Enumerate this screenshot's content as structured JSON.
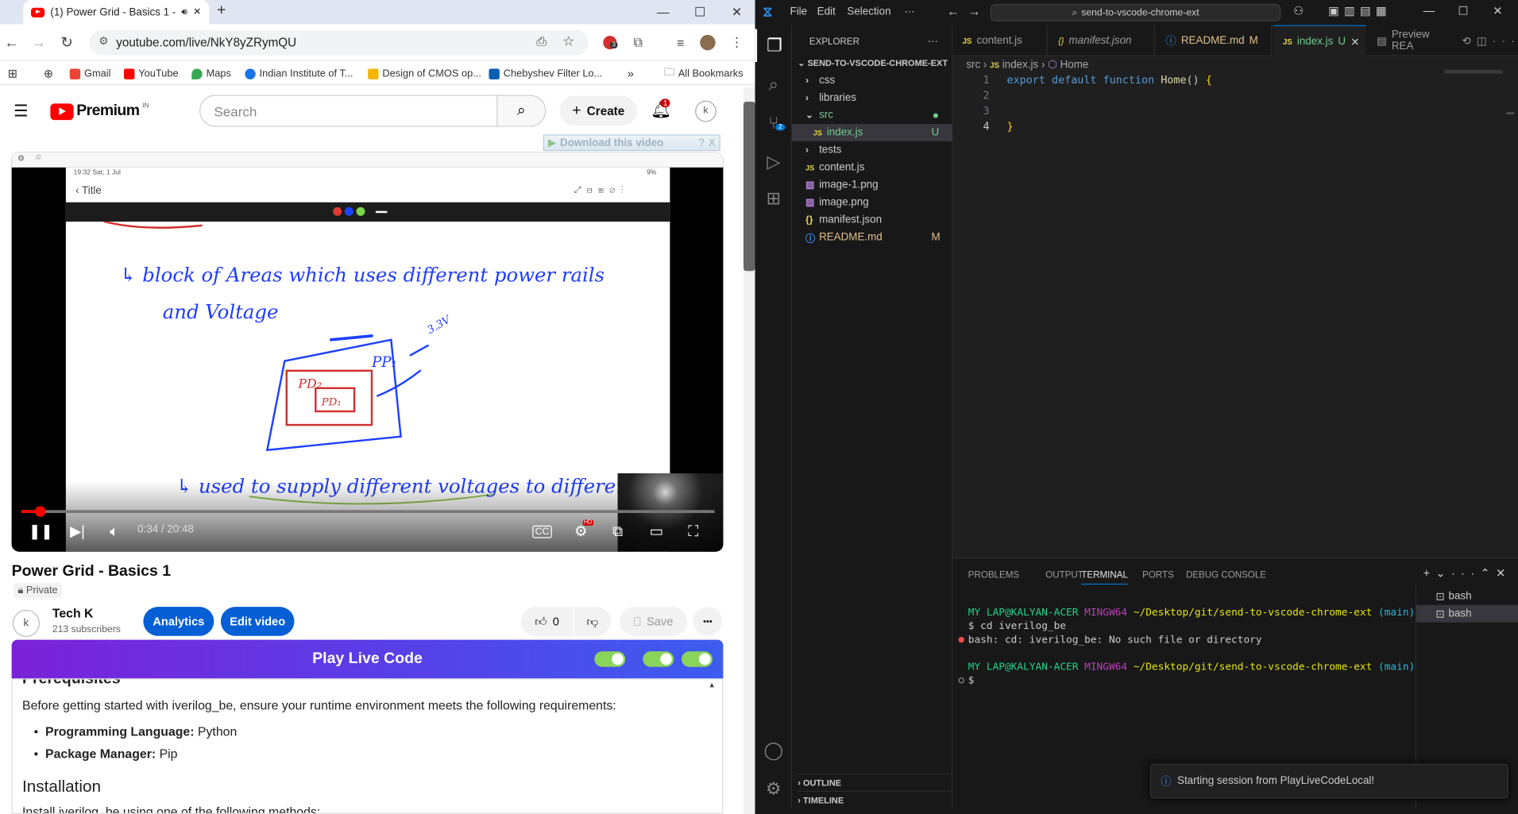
{
  "chrome": {
    "tab": {
      "title": "(1) Power Grid - Basics 1 - Y",
      "audio_icon": "speaker-icon",
      "close": "✕"
    },
    "new_tab": "+",
    "window_controls": {
      "minimize": "—",
      "maximize": "☐",
      "close": "✕"
    },
    "url": "youtube.com/live/NkY8yZRymQU",
    "extension_badge": "3",
    "bookmarks": [
      {
        "label": "Gmail",
        "color": "#ea4335"
      },
      {
        "label": "YouTube",
        "color": "#ff0000"
      },
      {
        "label": "Maps",
        "color": "#34a853"
      },
      {
        "label": "Indian Institute of T...",
        "color": "#1a73e8"
      },
      {
        "label": "Design of CMOS op...",
        "color": "#f4b400"
      },
      {
        "label": "Chebyshev Filter Lo...",
        "color": "#0b5fb0"
      }
    ],
    "bookmarks_more": "»",
    "all_bookmarks": "All Bookmarks"
  },
  "youtube": {
    "logo_text": "Premium",
    "logo_region": "IN",
    "search_placeholder": "Search",
    "create_label": "Create",
    "notifications_count": "1",
    "account_initial": "k",
    "download_bar": "Download this video",
    "download_help": "?",
    "download_close": "X",
    "player": {
      "status_time": "19:32  Sat, 1 Jul",
      "battery": "9%",
      "slide_title": "Title",
      "slide_text_line1": "↳ block of Areas which uses different power rails",
      "slide_text_line2": "and Voltage",
      "slide_label_pd2": "PD₂",
      "slide_label_pd1": "PD₁",
      "slide_label_pp1": "PP₁",
      "slide_label_volt": "3.3V",
      "slide_text_line3": "↳ used to supply different voltages to different",
      "time": "0:34 / 20:48",
      "progress": 0.027,
      "quality_badge": "HD"
    },
    "video_title": "Power Grid - Basics 1",
    "privacy": "Private",
    "channel_name": "Tech K",
    "subscribers": "213 subscribers",
    "analytics_label": "Analytics",
    "edit_label": "Edit video",
    "like_count": "0",
    "save_label": "Save",
    "more": "•••"
  },
  "playlivecode": {
    "title": "Play Live Code",
    "toggles": [
      true,
      true,
      true
    ],
    "cut_heading": "Prerequisites",
    "intro": "Before getting started with iverilog_be, ensure your runtime environment meets the following requirements:",
    "requirements": [
      {
        "key": "Programming Language:",
        "value": " Python"
      },
      {
        "key": "Package Manager:",
        "value": " Pip"
      }
    ],
    "install_heading": "Installation",
    "install_text": "Install iverilog_be using one of the following methods:"
  },
  "vscode": {
    "menu": [
      "File",
      "Edit",
      "Selection",
      "···"
    ],
    "command_center": "send-to-vscode-chrome-ext",
    "explorer_label": "EXPLORER",
    "project": "SEND-TO-VSCODE-CHROME-EXT",
    "tree": [
      {
        "label": "css",
        "kind": "folder",
        "indent": 0
      },
      {
        "label": "libraries",
        "kind": "folder",
        "indent": 0
      },
      {
        "label": "src",
        "kind": "folder-open",
        "indent": 0,
        "color": "#73c991"
      },
      {
        "label": "index.js",
        "kind": "js",
        "indent": 1,
        "color": "#73c991",
        "badge": "U",
        "selected": true
      },
      {
        "label": "tests",
        "kind": "folder",
        "indent": 0
      },
      {
        "label": "content.js",
        "kind": "js",
        "indent": 0
      },
      {
        "label": "image-1.png",
        "kind": "img",
        "indent": 0
      },
      {
        "label": "image.png",
        "kind": "img",
        "indent": 0
      },
      {
        "label": "manifest.json",
        "kind": "json",
        "indent": 0
      },
      {
        "label": "README.md",
        "kind": "info",
        "indent": 0,
        "color": "#e2c08d",
        "badge": "M"
      }
    ],
    "outline_label": "OUTLINE",
    "timeline_label": "TIMELINE",
    "tabs": [
      {
        "label": "content.js",
        "icon": "JS",
        "active": false
      },
      {
        "label": "manifest.json",
        "icon": "{}",
        "active": false,
        "italic": true
      },
      {
        "label": "README.md",
        "icon": "ⓘ",
        "badge": "M",
        "active": false,
        "color": "#e2c08d"
      },
      {
        "label": "index.js",
        "icon": "JS",
        "badge": "U",
        "active": true,
        "color": "#73c991"
      },
      {
        "label": "Preview REA",
        "icon": "▤",
        "active": false
      }
    ],
    "breadcrumb": [
      "src",
      "index.js",
      "Home"
    ],
    "code": [
      {
        "ln": "1",
        "text": "export default function Home() {"
      },
      {
        "ln": "2",
        "text": ""
      },
      {
        "ln": "3",
        "text": ""
      },
      {
        "ln": "4",
        "text": "}"
      }
    ],
    "panel_tabs": [
      "PROBLEMS",
      "OUTPUT",
      "TERMINAL",
      "PORTS",
      "DEBUG CONSOLE"
    ],
    "active_panel_tab": "TERMINAL",
    "terminal": {
      "prompt_user": "MY LAP@KALYAN-ACER",
      "prompt_env": "MINGW64",
      "prompt_path": "~/Desktop/git/send-to-vscode-chrome-ext",
      "prompt_branch": "(main)",
      "cmd1": "$ cd iverilog_be",
      "error": "bash: cd: iverilog_be: No such file or directory",
      "cmd2": "$"
    },
    "terminal_list": [
      "bash",
      "bash"
    ],
    "notification": "Starting session from PlayLiveCodeLocal!",
    "source_control_badge": "2"
  }
}
